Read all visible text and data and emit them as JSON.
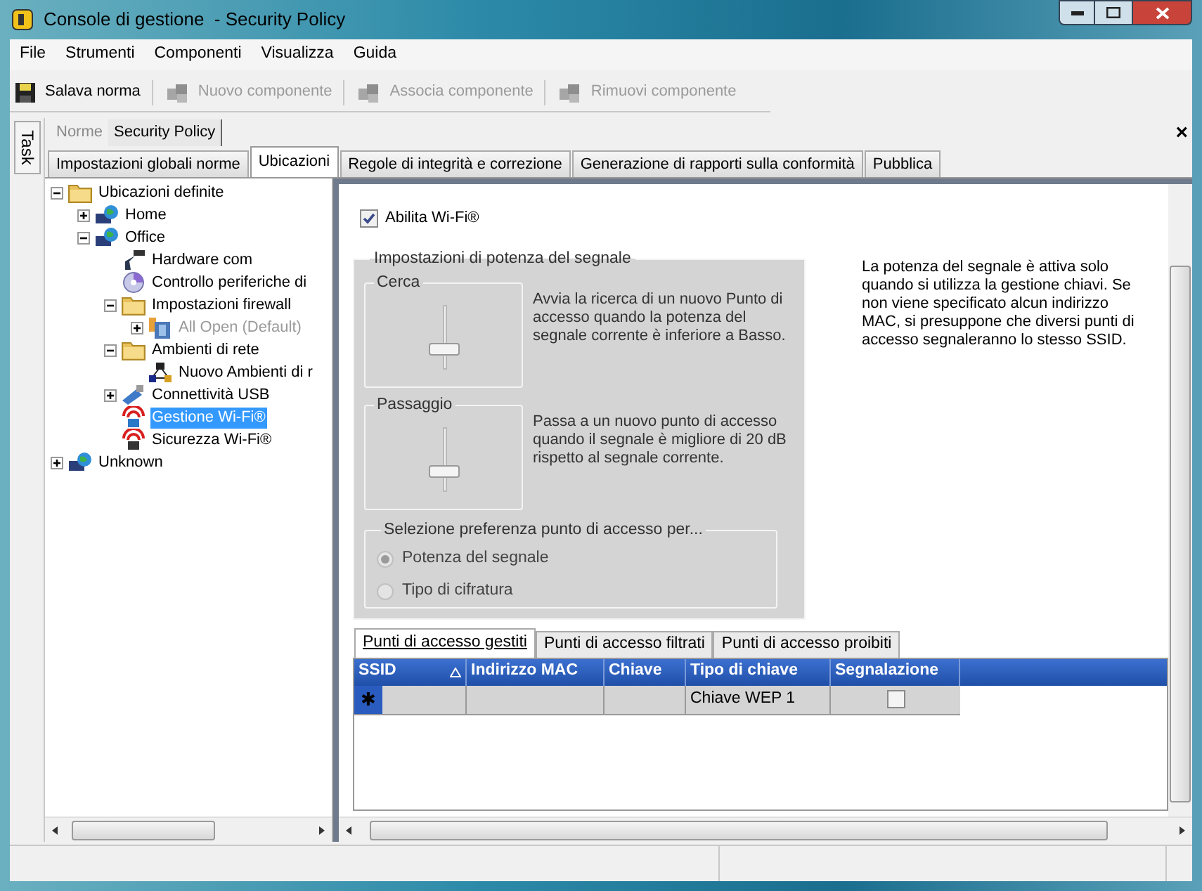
{
  "window": {
    "title": "Console di gestione  - Security Policy"
  },
  "menu": [
    "File",
    "Strumenti",
    "Componenti",
    "Visualizza",
    "Guida"
  ],
  "toolbar": [
    {
      "kind": "save",
      "label": "Salava norma",
      "disabled": false
    },
    {
      "kind": "new",
      "label": "Nuovo componente",
      "disabled": true
    },
    {
      "kind": "link",
      "label": "Associa componente",
      "disabled": true
    },
    {
      "kind": "remove",
      "label": "Rimuovi componente",
      "disabled": true
    }
  ],
  "side_tab": "Task",
  "document_tabs": [
    {
      "label": "Norme",
      "selected": false
    },
    {
      "label": "Security Policy",
      "selected": true
    }
  ],
  "close_label": "×",
  "section_tabs": [
    {
      "label": "Impostazioni globali norme",
      "selected": false
    },
    {
      "label": "Ubicazioni",
      "selected": true
    },
    {
      "label": "Regole di integrità e correzione",
      "selected": false
    },
    {
      "label": "Generazione di rapporti sulla conformità",
      "selected": false
    },
    {
      "label": "Pubblica",
      "selected": false
    }
  ],
  "tree": [
    {
      "label": "Ubicazioni definite",
      "kind": "folder",
      "expandable": true,
      "expanded": true,
      "selected": false,
      "disabled": false,
      "children": [
        {
          "label": "Home",
          "kind": "location",
          "expandable": true,
          "expanded": false,
          "selected": false,
          "disabled": false
        },
        {
          "label": "Office",
          "kind": "location",
          "expandable": true,
          "expanded": true,
          "selected": false,
          "disabled": false,
          "children": [
            {
              "label": "Hardware com",
              "kind": "hardware",
              "expandable": false,
              "selected": false,
              "disabled": false
            },
            {
              "label": "Controllo periferiche di",
              "kind": "disc",
              "expandable": false,
              "selected": false,
              "disabled": false
            },
            {
              "label": "Impostazioni firewall",
              "kind": "folder",
              "expandable": true,
              "expanded": true,
              "selected": false,
              "disabled": false,
              "children": [
                {
                  "label": "All Open (Default)",
                  "kind": "firewall",
                  "expandable": true,
                  "expanded": false,
                  "selected": false,
                  "disabled": true
                }
              ]
            },
            {
              "label": "Ambienti di rete",
              "kind": "folder",
              "expandable": true,
              "expanded": true,
              "selected": false,
              "disabled": false,
              "children": [
                {
                  "label": "Nuovo Ambienti di r",
                  "kind": "network",
                  "expandable": false,
                  "selected": false,
                  "disabled": false
                }
              ]
            },
            {
              "label": "Connettività USB",
              "kind": "usb",
              "expandable": true,
              "expanded": false,
              "selected": false,
              "disabled": false
            },
            {
              "label": "Gestione Wi-Fi®",
              "kind": "wifi",
              "expandable": false,
              "selected": true,
              "disabled": false
            },
            {
              "label": "Sicurezza Wi-Fi®",
              "kind": "wifi-lock",
              "expandable": false,
              "selected": false,
              "disabled": false
            }
          ]
        }
      ]
    },
    {
      "label": "Unknown",
      "kind": "location",
      "expandable": true,
      "expanded": false,
      "selected": false,
      "disabled": false
    }
  ],
  "enable_wifi": {
    "label": "Abilita Wi-Fi®",
    "checked": true
  },
  "signal_group": {
    "title": "Impostazioni di potenza del segnale",
    "sliders": [
      {
        "title": "Cerca",
        "level": 0.3,
        "description": "Avvia la ricerca di un nuovo Punto di accesso quando la potenza del segnale corrente è inferiore a Basso."
      },
      {
        "title": "Passaggio",
        "level": 0.3,
        "description": "Passa a un nuovo punto di accesso quando il segnale è migliore di 20 dB rispetto al segnale corrente."
      }
    ],
    "preference": {
      "title": "Selezione preferenza punto di accesso per...",
      "options": [
        {
          "label": "Potenza del segnale",
          "selected": true
        },
        {
          "label": "Tipo di cifratura",
          "selected": false
        }
      ]
    }
  },
  "note": "La potenza del segnale è attiva solo quando si utilizza la gestione chiavi. Se non viene specificato alcun indirizzo MAC, si presuppone che diversi punti di accesso segnaleranno lo stesso SSID.",
  "access_point_tabs": [
    {
      "label": "Punti di accesso gestiti",
      "selected": true
    },
    {
      "label": "Punti di accesso filtrati",
      "selected": false
    },
    {
      "label": "Punti di accesso proibiti",
      "selected": false
    }
  ],
  "table": {
    "columns": [
      {
        "label": "SSID",
        "sorted": true
      },
      {
        "label": "Indirizzo MAC",
        "sorted": false
      },
      {
        "label": "Chiave",
        "sorted": false
      },
      {
        "label": "Tipo di chiave",
        "sorted": false
      },
      {
        "label": "Segnalazione",
        "sorted": false
      }
    ],
    "rows": [
      {
        "marker": "✱",
        "ssid": "",
        "mac": "",
        "key": "",
        "key_type": "Chiave WEP 1",
        "signal_checked": false
      }
    ]
  }
}
